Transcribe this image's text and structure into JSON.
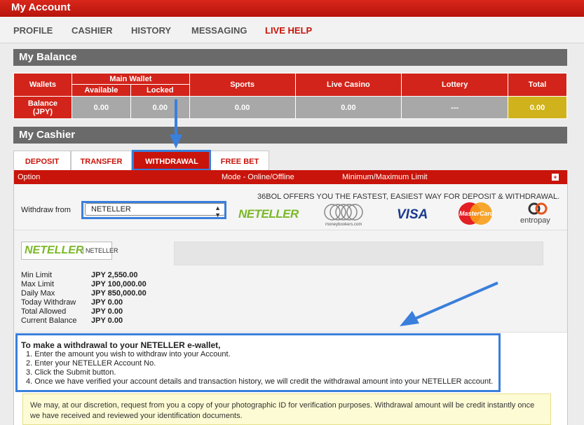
{
  "header": {
    "title": "My Account"
  },
  "nav": [
    {
      "label": "PROFILE"
    },
    {
      "label": "CASHIER"
    },
    {
      "label": "HISTORY"
    },
    {
      "label": "MESSAGING"
    },
    {
      "label": "LIVE HELP"
    }
  ],
  "balance": {
    "section_title": "My Balance",
    "headers": {
      "wallets": "Wallets",
      "main_wallet": "Main Wallet",
      "available": "Available",
      "locked": "Locked",
      "sports": "Sports",
      "live_casino": "Live Casino",
      "lottery": "Lottery",
      "total": "Total"
    },
    "row": {
      "label_line1": "Balance",
      "label_line2": "(JPY)",
      "available": "0.00",
      "locked": "0.00",
      "sports": "0.00",
      "live_casino": "0.00",
      "lottery": "---",
      "total": "0.00"
    }
  },
  "cashier": {
    "section_title": "My Cashier",
    "tabs": [
      {
        "label": "DEPOSIT"
      },
      {
        "label": "TRANSFER"
      },
      {
        "label": "WITHDRAWAL"
      },
      {
        "label": "FREE BET"
      }
    ],
    "active_tab": "WITHDRAWAL",
    "panel_headers": {
      "option": "Option",
      "mode": "Mode - Online/Offline",
      "limit": "Minimum/Maximum Limit",
      "toggle": "+"
    },
    "withdraw_from_label": "Withdraw from",
    "withdraw_from_value": "NETELLER",
    "offer_text": "36BOL OFFERS YOU THE FASTEST, EASIEST WAY FOR DEPOSIT & WITHDRAWAL.",
    "logos": {
      "neteller": "NETELLER",
      "moneybookers": "moneybookers.com",
      "visa": "VISA",
      "mastercard": "MasterCard",
      "entropay": "entropay"
    },
    "selected_method_logo": "NETELLER",
    "selected_method_name": "NETELLER",
    "limits": [
      {
        "label": "Min Limit",
        "value": "JPY 2,550.00"
      },
      {
        "label": "Max Limit",
        "value": "JPY 100,000.00"
      },
      {
        "label": "Daily Max",
        "value": "JPY 850,000.00"
      },
      {
        "label": "Today Withdraw",
        "value": "JPY 0.00"
      },
      {
        "label": "Total Allowed",
        "value": "JPY 0.00"
      },
      {
        "label": "Current Balance",
        "value": "JPY 0.00"
      }
    ],
    "instructions": {
      "title": "To make a withdrawal to your NETELLER e-wallet,",
      "steps": [
        "1.  Enter the amount you wish to withdraw into your Account.",
        "2.  Enter your NETELLER Account No.",
        "3.  Click the Submit button.",
        "4.  Once we have verified your account details and transaction history, we will credit the withdrawal amount into your NETELLER account."
      ]
    },
    "note": "We may, at our discretion, request from you a copy of your photographic ID for verification purposes. Withdrawal amount will be credit instantly once we have received and reviewed your identification documents."
  },
  "colors": {
    "brand_red": "#c8140a",
    "section_grey": "#6a6a6a",
    "total_gold": "#d0b21c",
    "highlight_blue": "#3a7fdc",
    "neteller_green": "#7ab828"
  }
}
